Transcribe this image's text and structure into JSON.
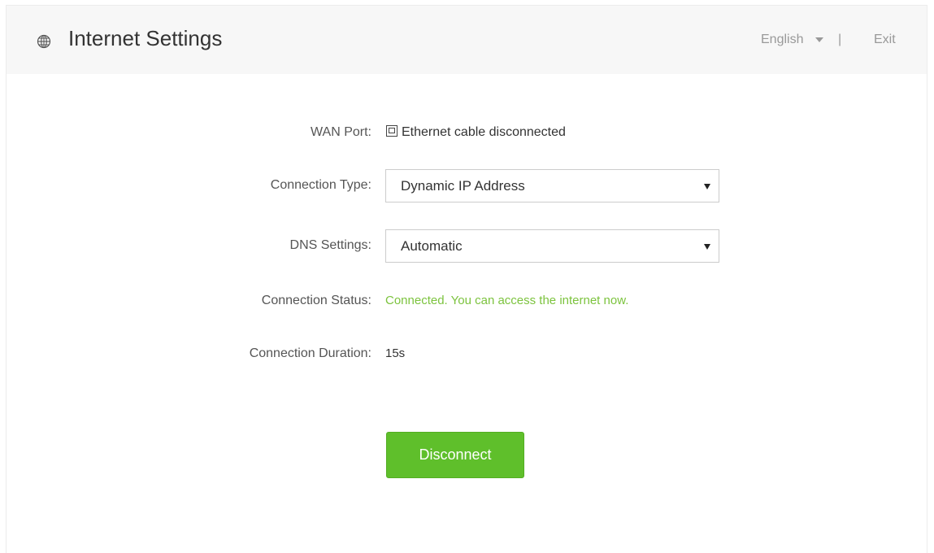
{
  "header": {
    "title": "Internet Settings",
    "language": "English",
    "separator": "|",
    "exit_label": "Exit",
    "icon": "globe-icon"
  },
  "form": {
    "wan_port": {
      "label": "WAN Port:",
      "value": "Ethernet cable disconnected",
      "icon": "ethernet-port-icon"
    },
    "connection_type": {
      "label": "Connection Type:",
      "selected": "Dynamic IP Address"
    },
    "dns_settings": {
      "label": "DNS Settings:",
      "selected": "Automatic"
    },
    "connection_status": {
      "label": "Connection Status:",
      "value": "Connected. You can access the internet now."
    },
    "connection_duration": {
      "label": "Connection Duration:",
      "value": "15s"
    }
  },
  "actions": {
    "disconnect_label": "Disconnect"
  },
  "colors": {
    "accent_green": "#5fbf2b",
    "status_green": "#7cc33e",
    "header_bg": "#f7f7f7"
  }
}
